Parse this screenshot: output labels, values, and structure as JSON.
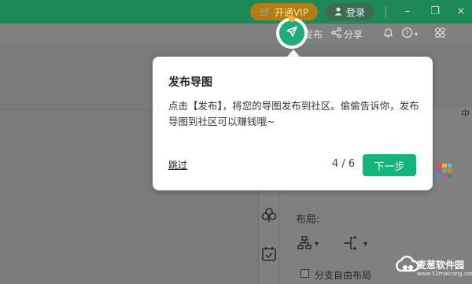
{
  "titlebar": {
    "vip_label": "开通VIP",
    "login_label": "登录",
    "minimize_glyph": "–",
    "restore_glyph": "❐",
    "close_glyph": "×"
  },
  "toolbar": {
    "publish_label": "发布",
    "share_label": "分享"
  },
  "tooltip": {
    "title": "发布导图",
    "body": "点击【发布】，将您的导图发布到社区。偷偷告诉你，发布导图到社区可以赚钱哦~",
    "skip_label": "跳过",
    "progress": "4 / 6",
    "next_label": "下一步"
  },
  "panel": {
    "layout_label": "布局:",
    "free_layout_label": "分支自由布局",
    "edge_glyph": "中"
  },
  "watermark": {
    "name": "麦葱软件园",
    "url": "www.52maicong.com"
  },
  "colors": {
    "brand_green": "#1d8a55",
    "vip_gold": "#b57c12",
    "accent_button": "#12b57a"
  }
}
